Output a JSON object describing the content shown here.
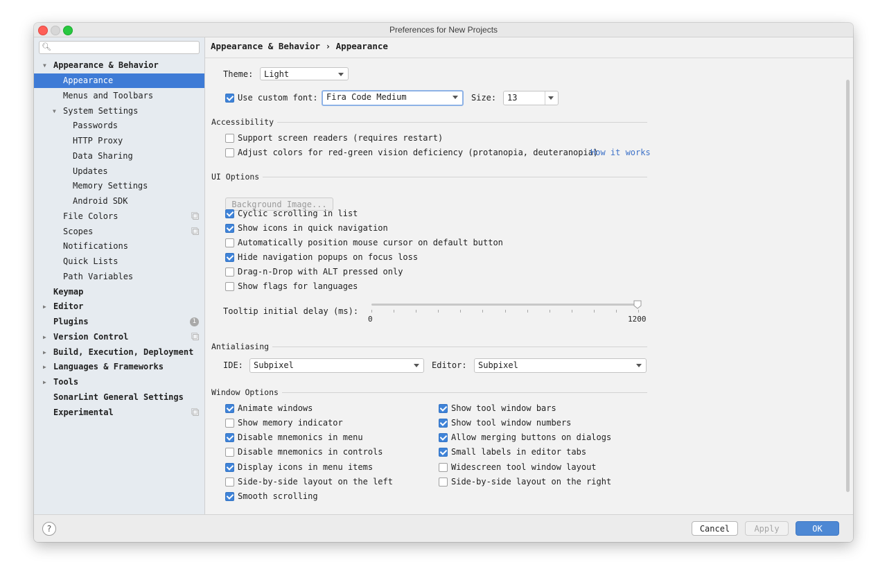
{
  "window": {
    "title": "Preferences for New Projects"
  },
  "search": {
    "placeholder": ""
  },
  "sidebar": {
    "items": [
      {
        "label": "Appearance & Behavior"
      },
      {
        "label": "Appearance"
      },
      {
        "label": "Menus and Toolbars"
      },
      {
        "label": "System Settings"
      },
      {
        "label": "Passwords"
      },
      {
        "label": "HTTP Proxy"
      },
      {
        "label": "Data Sharing"
      },
      {
        "label": "Updates"
      },
      {
        "label": "Memory Settings"
      },
      {
        "label": "Android SDK"
      },
      {
        "label": "File Colors"
      },
      {
        "label": "Scopes"
      },
      {
        "label": "Notifications"
      },
      {
        "label": "Quick Lists"
      },
      {
        "label": "Path Variables"
      },
      {
        "label": "Keymap"
      },
      {
        "label": "Editor"
      },
      {
        "label": "Plugins",
        "badge": "1"
      },
      {
        "label": "Version Control"
      },
      {
        "label": "Build, Execution, Deployment"
      },
      {
        "label": "Languages & Frameworks"
      },
      {
        "label": "Tools"
      },
      {
        "label": "SonarLint General Settings"
      },
      {
        "label": "Experimental"
      }
    ]
  },
  "breadcrumb": {
    "parent": "Appearance & Behavior",
    "separator": "›",
    "current": "Appearance"
  },
  "theme": {
    "label": "Theme:",
    "value": "Light"
  },
  "font": {
    "checkbox_label": "Use custom font:",
    "checked": true,
    "value": "Fira Code Medium",
    "size_label": "Size:",
    "size_value": "13"
  },
  "accessibility": {
    "title": "Accessibility",
    "screen_readers": {
      "label": "Support screen readers (requires restart)",
      "checked": false
    },
    "color_deficiency": {
      "label": "Adjust colors for red-green vision deficiency (protanopia, deuteranopia)",
      "checked": false,
      "link": "How it works"
    }
  },
  "ui_options": {
    "title": "UI Options",
    "background_button": "Background Image...",
    "options": [
      {
        "label": "Cyclic scrolling in list",
        "checked": true
      },
      {
        "label": "Show icons in quick navigation",
        "checked": true
      },
      {
        "label": "Automatically position mouse cursor on default button",
        "checked": false
      },
      {
        "label": "Hide navigation popups on focus loss",
        "checked": true
      },
      {
        "label": "Drag-n-Drop with ALT pressed only",
        "checked": false
      },
      {
        "label": "Show flags for languages",
        "checked": false
      }
    ],
    "tooltip": {
      "label": "Tooltip initial delay (ms):",
      "min": "0",
      "max": "1200",
      "value_fraction": 1.0
    }
  },
  "antialiasing": {
    "title": "Antialiasing",
    "ide_label": "IDE:",
    "ide_value": "Subpixel",
    "editor_label": "Editor:",
    "editor_value": "Subpixel"
  },
  "window_options": {
    "title": "Window Options",
    "left": [
      {
        "label": "Animate windows",
        "checked": true
      },
      {
        "label": "Show memory indicator",
        "checked": false
      },
      {
        "label": "Disable mnemonics in menu",
        "checked": true
      },
      {
        "label": "Disable mnemonics in controls",
        "checked": false
      },
      {
        "label": "Display icons in menu items",
        "checked": true
      },
      {
        "label": "Side-by-side layout on the left",
        "checked": false
      },
      {
        "label": "Smooth scrolling",
        "checked": true
      }
    ],
    "right": [
      {
        "label": "Show tool window bars",
        "checked": true
      },
      {
        "label": "Show tool window numbers",
        "checked": true
      },
      {
        "label": "Allow merging buttons on dialogs",
        "checked": true
      },
      {
        "label": "Small labels in editor tabs",
        "checked": true
      },
      {
        "label": "Widescreen tool window layout",
        "checked": false
      },
      {
        "label": "Side-by-side layout on the right",
        "checked": false
      }
    ]
  },
  "footer": {
    "help": "?",
    "cancel": "Cancel",
    "apply": "Apply",
    "ok": "OK"
  },
  "colors": {
    "accent": "#3e7bd6",
    "sidebar_bg": "#e6ebf0",
    "link": "#3d72c8",
    "ok_button": "#4d88d4"
  }
}
